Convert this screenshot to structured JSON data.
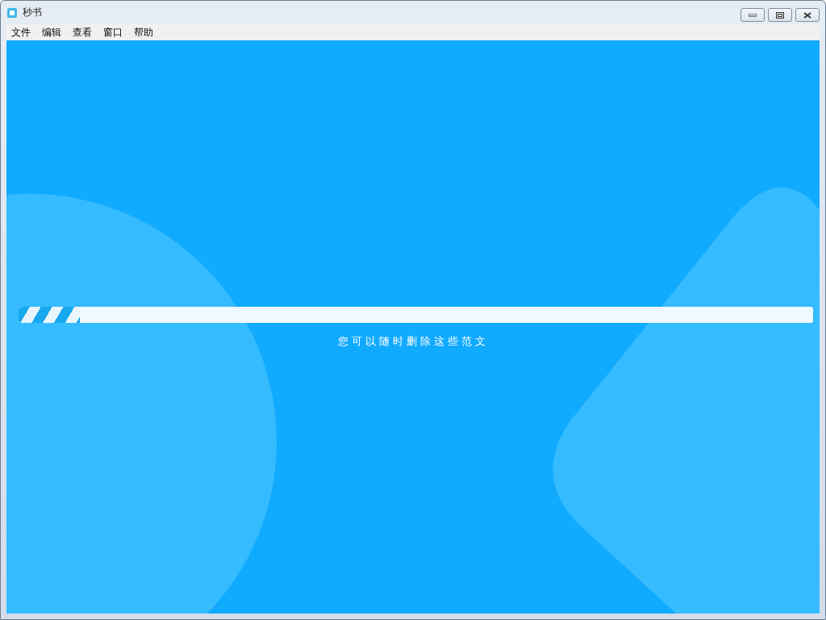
{
  "window": {
    "title": "秒书"
  },
  "menu": [
    "文件",
    "编辑",
    "查看",
    "窗口",
    "帮助"
  ],
  "progress": {
    "level": 0.077
  },
  "message": "您可以随时删除这些范文"
}
